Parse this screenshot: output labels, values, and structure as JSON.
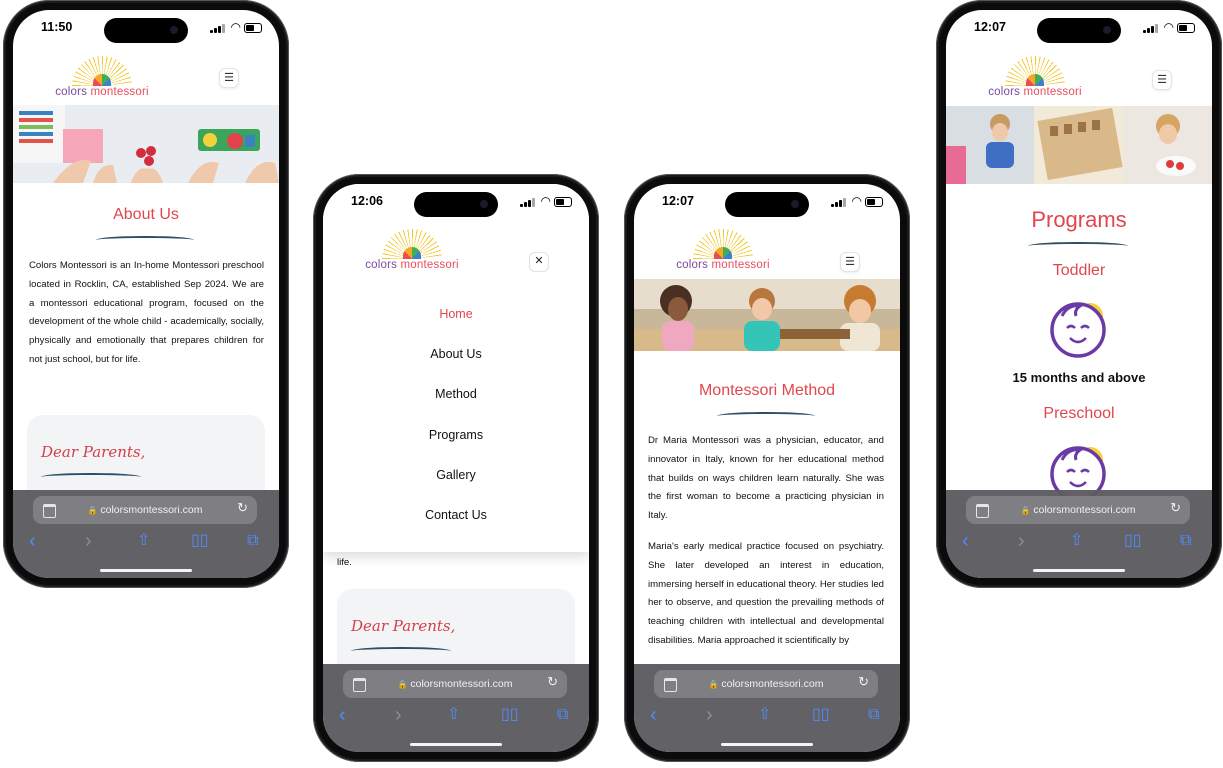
{
  "brand": {
    "logo_word1": "colors",
    "logo_word2": "montessori",
    "url": "colorsmontessori.com"
  },
  "colors": {
    "accent_red": "#e0474c",
    "swoosh_navy": "#2d4e64",
    "logo_purple": "#7c4aa0",
    "safari_link_blue": "#4f8cff"
  },
  "icons": {
    "menu": "☰",
    "close": "✕",
    "reload": "↻",
    "back": "‹",
    "forward": "›",
    "share": "share-icon",
    "bookmarks": "book-icon",
    "tabs": "tabs-icon",
    "lock": "🔒"
  },
  "phones": [
    {
      "time": "11:50",
      "section_title": "About Us",
      "body": "Colors Montessori is an In-home Montessori preschool located in Rocklin, CA, established Sep 2024. We are a montessori educational program, focused on the development of the whole child - academically, socially, physically and emotionally that prepares children for not just school, but for life.",
      "card_title": "Dear Parents,"
    },
    {
      "time": "12:06",
      "menu": [
        "Home",
        "About Us",
        "Method",
        "Programs",
        "Gallery",
        "Contact Us"
      ],
      "peek_text": "life.",
      "card_title": "Dear Parents,"
    },
    {
      "time": "12:07",
      "section_title": "Montessori Method",
      "para1": "Dr Maria Montessori was a physician, educator, and innovator in Italy, known for her educational method that builds on ways children learn naturally. She was the first woman to become a practicing physician in Italy.",
      "para2": "Maria's early medical practice focused on psychiatry. She later developed an interest in education, immersing herself in educational theory. Her studies led her to observe, and question the prevailing methods of teaching children with intellectual and developmental disabilities. Maria approached it scientifically by"
    },
    {
      "time": "12:07",
      "section_title": "Programs",
      "program1_title": "Toddler",
      "program1_age": "15 months and above",
      "program2_title": "Preschool"
    }
  ]
}
